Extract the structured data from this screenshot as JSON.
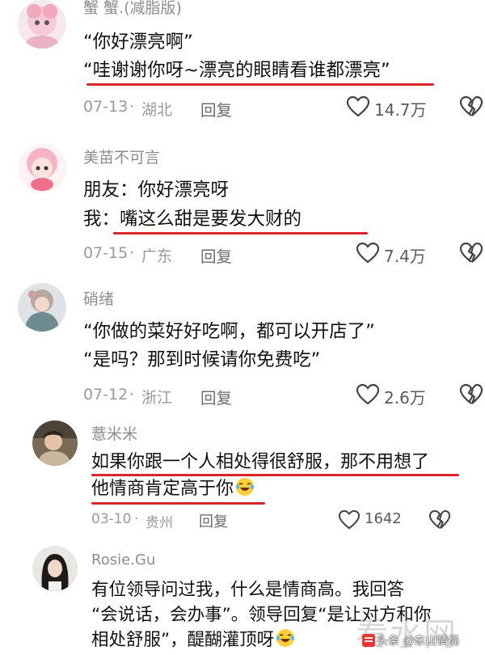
{
  "comments": [
    {
      "username": "蟹 蟹.(减脂版)",
      "lines": [
        "“你好漂亮啊”",
        "“哇谢谢你呀~漂亮的眼睛看谁都漂亮”"
      ],
      "date": "07-13",
      "location": "湖北",
      "reply_label": "回复",
      "likes": "14.7万",
      "avatar_icon": "pink-cartoon-girl-avatar"
    },
    {
      "username": "美苗不可言",
      "lines": [
        "朋友：你好漂亮呀",
        "我：嘴这么甜是要发大财的"
      ],
      "date": "07-15",
      "location": "广东",
      "reply_label": "回复",
      "likes": "7.4万",
      "avatar_icon": "pink-haired-anime-avatar"
    },
    {
      "username": "硝绪",
      "lines": [
        "“你做的菜好好吃啊，都可以开店了”",
        "“是吗？那到时候请你免费吃”"
      ],
      "date": "07-12",
      "location": "浙江",
      "reply_label": "回复",
      "likes": "2.6万",
      "avatar_icon": "illustrated-girl-avatar"
    },
    {
      "username": "薏米米",
      "lines": [
        "如果你跟一个人相处得很舒服，那不用想了",
        "他情商肯定高于你"
      ],
      "date": "03-10",
      "location": "贵州",
      "reply_label": "回复",
      "likes": "1642",
      "avatar_icon": "photo-person-avatar"
    },
    {
      "username": "Rosie.Gu",
      "lines": [
        "有位领导问过我，什么是情商高。我回答",
        "“会说话，会办事”。领导回复“是让对方和你",
        "相处舒服”，醍醐灌顶呀"
      ],
      "avatar_icon": "dark-haired-girl-avatar"
    }
  ],
  "watermark": {
    "source": "头条 @东山情局",
    "overlay": "看水网"
  },
  "colors": {
    "underline": "#d9262c",
    "username": "#8d8d8d",
    "meta": "#9a9a9a"
  },
  "icons": [
    "heart-outline-icon",
    "broken-heart-icon",
    "laughing-crying-emoji",
    "toutiao-logo"
  ]
}
